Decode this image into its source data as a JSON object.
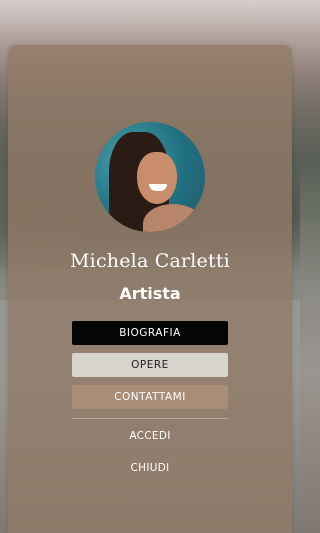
{
  "profile": {
    "name": "Michela Carletti",
    "role": "Artista"
  },
  "menu": {
    "bio_label": "BIOGRAFIA",
    "works_label": "OPERE",
    "contact_label": "CONTATTAMI",
    "login_label": "ACCEDI",
    "close_label": "CHIUDI"
  },
  "colors": {
    "card": "#917a66",
    "bio_button": "#050505",
    "works_button": "#d7d3cd",
    "contact_button": "#a88e78"
  }
}
